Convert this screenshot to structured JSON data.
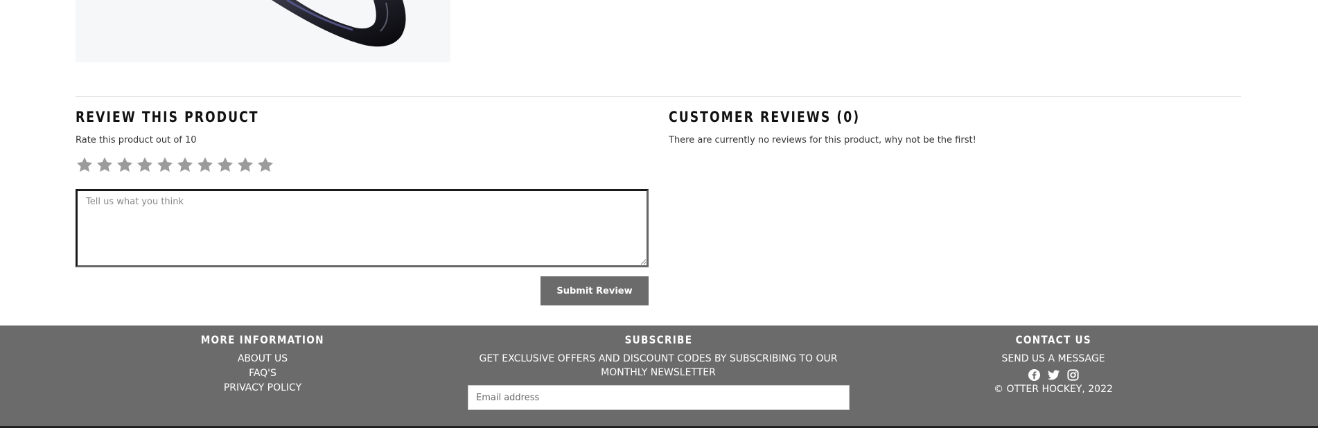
{
  "review": {
    "title": "Review this product",
    "rate_label": "Rate this product out of 10",
    "rating": 0,
    "max_rating": 10,
    "textarea_placeholder": "Tell us what you think",
    "submit_label": "Submit Review"
  },
  "customer_reviews": {
    "title": "Customer Reviews (0)",
    "empty_message": "There are currently no reviews for this product, why not be the first!"
  },
  "footer": {
    "more_info": {
      "heading": "More Information",
      "links": [
        "ABOUT US",
        "FAQ'S",
        "PRIVACY POLICY"
      ]
    },
    "subscribe": {
      "heading": "Subscribe",
      "text": "GET EXCLUSIVE OFFERS AND DISCOUNT CODES BY SUBSCRIBING TO OUR MONTHLY NEWSLETTER",
      "email_placeholder": "Email address"
    },
    "contact": {
      "heading": "Contact Us",
      "message_link": "SEND US A MESSAGE",
      "social_icons": [
        "facebook-icon",
        "twitter-icon",
        "instagram-icon"
      ],
      "copyright": "© OTTER HOCKEY, 2022"
    }
  },
  "colors": {
    "footer_bg": "#6b6b6b",
    "button_bg": "#6b6b6b",
    "star": "#9b9b9b",
    "heading": "#111111"
  }
}
